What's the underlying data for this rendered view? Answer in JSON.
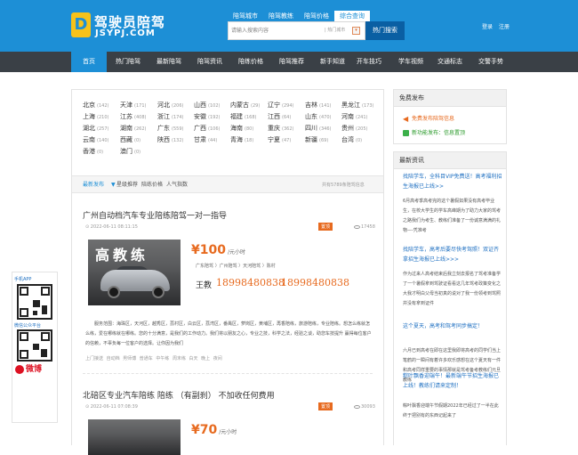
{
  "header": {
    "logo_cn": "驾驶员陪驾",
    "logo_en": "JSYPJ.COM",
    "search_tabs": [
      "陪驾城市",
      "陪驾教练",
      "陪驾价格",
      "综合查询"
    ],
    "search_placeholder": "请输入搜索内容",
    "search_city": "| 热门城市",
    "search_button": "热门搜索",
    "login": "登录",
    "register": "注册"
  },
  "nav": [
    "首页",
    "热门陪驾",
    "最新陪驾",
    "陪驾资讯",
    "陪练价格",
    "陪驾推荐",
    "新手知道",
    "开车技巧",
    "学车视频",
    "交通标志",
    "交警手势"
  ],
  "cities": [
    {
      "name": "北京",
      "count": "(142)"
    },
    {
      "name": "天津",
      "count": "(171)"
    },
    {
      "name": "河北",
      "count": "(206)"
    },
    {
      "name": "山西",
      "count": "(102)"
    },
    {
      "name": "内蒙古",
      "count": "(29)"
    },
    {
      "name": "辽宁",
      "count": "(294)"
    },
    {
      "name": "吉林",
      "count": "(141)"
    },
    {
      "name": "黑龙江",
      "count": "(173)"
    },
    {
      "name": "上海",
      "count": "(210)"
    },
    {
      "name": "江苏",
      "count": "(408)"
    },
    {
      "name": "浙江",
      "count": "(174)"
    },
    {
      "name": "安徽",
      "count": "(192)"
    },
    {
      "name": "福建",
      "count": "(168)"
    },
    {
      "name": "江西",
      "count": "(64)"
    },
    {
      "name": "山东",
      "count": "(470)"
    },
    {
      "name": "河南",
      "count": "(241)"
    },
    {
      "name": "湖北",
      "count": "(257)"
    },
    {
      "name": "湖南",
      "count": "(262)"
    },
    {
      "name": "广东",
      "count": "(559)"
    },
    {
      "name": "广西",
      "count": "(106)"
    },
    {
      "name": "海南",
      "count": "(80)"
    },
    {
      "name": "重庆",
      "count": "(362)"
    },
    {
      "name": "四川",
      "count": "(346)"
    },
    {
      "name": "贵州",
      "count": "(205)"
    },
    {
      "name": "云南",
      "count": "(140)"
    },
    {
      "name": "西藏",
      "count": "(0)"
    },
    {
      "name": "陕西",
      "count": "(132)"
    },
    {
      "name": "甘肃",
      "count": "(44)"
    },
    {
      "name": "青海",
      "count": "(18)"
    },
    {
      "name": "宁夏",
      "count": "(47)"
    },
    {
      "name": "新疆",
      "count": "(69)"
    },
    {
      "name": "台湾",
      "count": "(0)"
    },
    {
      "name": "香港",
      "count": "(0)"
    },
    {
      "name": "澳门",
      "count": "(0)"
    }
  ],
  "list": {
    "tabs": [
      "最新发布",
      "星级推荐",
      "陪练价格",
      "人气指数"
    ],
    "total": "共有5789条陪驾信息"
  },
  "articles": [
    {
      "title": "广州自动档汽车专业陪练陪驾一对一指导",
      "date": "2022-06-11 08:11:15",
      "badge": "置顶",
      "views": "17458",
      "photo_text": "高教练",
      "price": "¥100",
      "unit": "/元小时",
      "crumb": "广东陪驾 〉广州陪驾 〉天河陪驾 〉陈村",
      "teacher": "王教",
      "phone1": "18998480838",
      "phone2": "18998480838",
      "desc": "服务范围：海珠区，天河区，越秀区，荔村区，白云区，荔湾区，番禺区，萝岗区，黄埔区，再香陪练，旅游陪练，专业陪练。想怎么练就怎么练，爱在哪练就在哪练。您的十分满意，是我们的工作动力。我们将以朋友之心，专业之技，科学之法，经验之谈，助您车技提升 赢得每位客户的信赖，不辜负每一位客户的选择。让你因为我们",
      "tags": "上门接送 自动档 男师傅 普通车 中午练 周末练 白天 晚上 夜间"
    },
    {
      "title": "北碚区专业汽车陪练 陪练 （有副刹） 不加收任何费用",
      "date": "2022-06-11 07:08:39",
      "badge": "置顶",
      "views": "30093",
      "price": "¥70",
      "unit": "/元小时"
    }
  ],
  "sidebar": {
    "publish_title": "免费发布",
    "publish_items": [
      "免费发布陪驾信息",
      "新功能发布：信息置顶"
    ],
    "news_title": "最新资讯",
    "news": [
      {
        "title": "找陪学车，全科目VIP免费送！高考福利招生海报已上线>>",
        "desc": "6月高考季高考完的这个暑假如果没有高考毕业生，在校大学生的学车高峰期为了助力大家的驾考之路我们为考生、教练们准备了一份诚意满满的礼物—-凭准考"
      },
      {
        "title": "找陪学车，高考后要尽快考驾照！双证齐拿招生海报已上线>>>",
        "desc": "作为过来人高考结束后我立刻去报名了驾考准备学了一个暑假拿到驾驶证看看这几年驾考政策变化之大我才明白父母当初真的说对了我一份领考到驾照并没有拿到证件"
      },
      {
        "title": "这个夏天，高考和驾考同步搞定！",
        "desc": "六月已到高考在即在这里我即将高考的同学们当上笔鹤的一瞬间有着许多欢乐感想在这个夏天有一件和高考同样重要的事情那就是驾考备考教练们元旦教练"
      },
      {
        "title": "粽叶飘香迎端午！最新端午节招生海报已上线！教练们请来定制！",
        "desc": "粽叶飘香迎端午节假期2022年已经过了一半在此终于把别有的东西记起来了"
      }
    ]
  },
  "float": {
    "phone_label": "手机APP",
    "wechat_label": "微信公众平台",
    "weibo": "微博"
  }
}
